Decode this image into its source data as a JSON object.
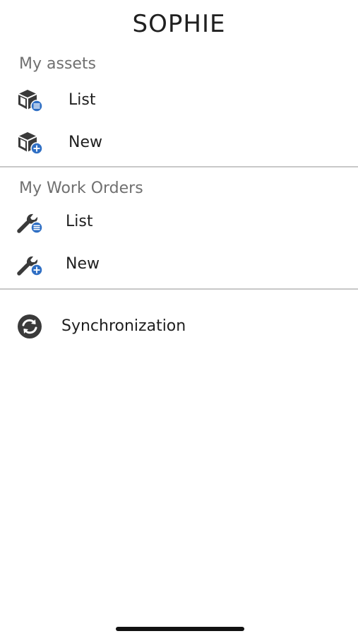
{
  "header": {
    "title": "SOPHIE"
  },
  "sections": {
    "assets": {
      "heading": "My assets",
      "list_label": "List",
      "new_label": "New"
    },
    "work_orders": {
      "heading": "My Work Orders",
      "list_label": "List",
      "new_label": "New"
    },
    "sync": {
      "label": "Synchronization"
    }
  },
  "icons": {
    "asset_list": "box-list-icon",
    "asset_new": "box-add-icon",
    "work_order_list": "wrench-list-icon",
    "work_order_new": "wrench-add-icon",
    "sync": "sync-icon"
  },
  "colors": {
    "icon_dark": "#3a3a3a",
    "badge_blue": "#2f6fc4",
    "divider": "#c8c8c8",
    "heading_gray": "#707070"
  }
}
